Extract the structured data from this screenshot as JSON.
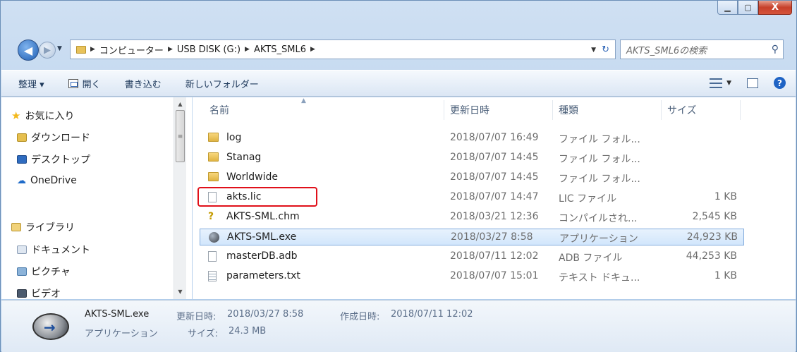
{
  "window": {
    "minimize_icon": "minimize-icon",
    "maximize_icon": "maximize-icon",
    "close_label": "X"
  },
  "address": {
    "crumbs": [
      "コンピューター",
      "USB DISK (G:)",
      "AKTS_SML6"
    ],
    "search_placeholder": "AKTS_SML6の検索"
  },
  "toolbar": {
    "organize": "整理 ▾",
    "open": "開く",
    "burn": "書き込む",
    "new_folder": "新しいフォルダー"
  },
  "sidebar": {
    "favorites": "お気に入り",
    "downloads": "ダウンロード",
    "desktop": "デスクトップ",
    "onedrive": "OneDrive",
    "libraries": "ライブラリ",
    "documents": "ドキュメント",
    "pictures": "ピクチャ",
    "videos": "ビデオ"
  },
  "columns": {
    "name": "名前",
    "modified": "更新日時",
    "type": "種類",
    "size": "サイズ"
  },
  "files": [
    {
      "name": "log",
      "modified": "2018/07/07 16:49",
      "type": "ファイル フォル...",
      "size": "",
      "icon": "folder"
    },
    {
      "name": "Stanag",
      "modified": "2018/07/07 14:45",
      "type": "ファイル フォル...",
      "size": "",
      "icon": "folder"
    },
    {
      "name": "Worldwide",
      "modified": "2018/07/07 14:45",
      "type": "ファイル フォル...",
      "size": "",
      "icon": "folder"
    },
    {
      "name": "akts.lic",
      "modified": "2018/07/07 14:47",
      "type": "LIC ファイル",
      "size": "1 KB",
      "icon": "document"
    },
    {
      "name": "AKTS-SML.chm",
      "modified": "2018/03/21 12:36",
      "type": "コンパイルされ...",
      "size": "2,545 KB",
      "icon": "help-file"
    },
    {
      "name": "AKTS-SML.exe",
      "modified": "2018/03/27 8:58",
      "type": "アプリケーション",
      "size": "24,923 KB",
      "icon": "application"
    },
    {
      "name": "masterDB.adb",
      "modified": "2018/07/11 12:02",
      "type": "ADB ファイル",
      "size": "44,253 KB",
      "icon": "document"
    },
    {
      "name": "parameters.txt",
      "modified": "2018/07/07 15:01",
      "type": "テキスト ドキュ...",
      "size": "1 KB",
      "icon": "text-file"
    }
  ],
  "details": {
    "filename": "AKTS-SML.exe",
    "filetype": "アプリケーション",
    "modified_label": "更新日時:",
    "modified_value": "2018/03/27 8:58",
    "created_label": "作成日時:",
    "created_value": "2018/07/11 12:02",
    "size_label": "サイズ:",
    "size_value": "24.3 MB"
  },
  "colors": {
    "highlight_box": "#e0101a",
    "selection": "#d2e6fc"
  }
}
